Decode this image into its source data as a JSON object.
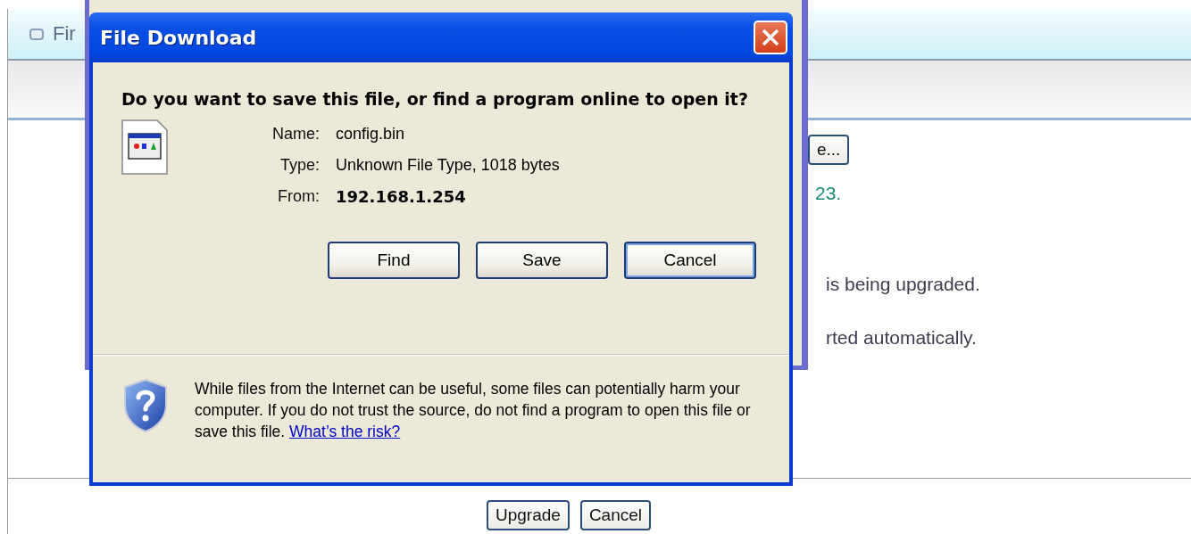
{
  "page": {
    "header_title": "Fir",
    "browse_button": "e...",
    "version_text": "23.",
    "notes": [
      "is being upgraded.",
      "rted automatically."
    ],
    "buttons": [
      "Upgrade",
      "Cancel"
    ]
  },
  "dialog": {
    "title": "File Download",
    "question": "Do you want to save this file, or find a program online to open it?",
    "fields": [
      {
        "label": "Name:",
        "value": "config.bin",
        "bold": false
      },
      {
        "label": "Type:",
        "value": "Unknown File Type, 1018 bytes",
        "bold": false
      },
      {
        "label": "From:",
        "value": "192.168.1.254",
        "bold": true
      }
    ],
    "buttons": [
      {
        "label": "Find",
        "focused": false
      },
      {
        "label": "Save",
        "focused": false
      },
      {
        "label": "Cancel",
        "focused": true
      }
    ],
    "warning": "While files from the Internet can be useful, some files can potentially harm your computer. If you do not trust the source, do not find a program to open this file or save this file.",
    "risk_link": "What’s the risk?"
  }
}
